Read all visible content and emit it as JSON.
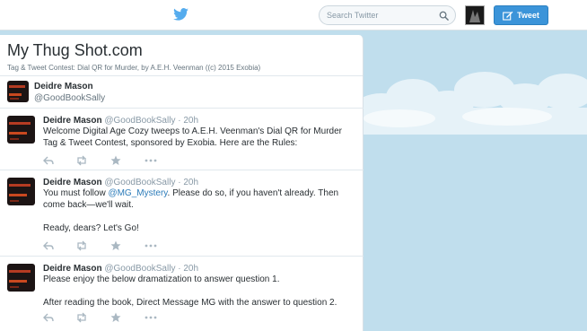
{
  "nav": {
    "search_placeholder": "Search Twitter",
    "tweet_button_label": "Tweet"
  },
  "page": {
    "title": "My Thug Shot.com",
    "subtitle": "Tag & Tweet Contest: Dial QR for Murder, by A.E.H. Veenman ((c) 2015 Exobia)"
  },
  "profile": {
    "name": "Deidre Mason",
    "handle": "@GoodBookSally"
  },
  "tweets": [
    {
      "name": "Deidre Mason",
      "handle": "@GoodBookSally",
      "separator": "·",
      "time": "20h",
      "text1": "Welcome Digital Age Cozy tweeps to A.E.H. Veenman's Dial QR for Murder Tag & Tweet Contest, sponsored by Exobia. Here are the Rules:"
    },
    {
      "name": "Deidre Mason",
      "handle": "@GoodBookSally",
      "separator": "·",
      "time": "20h",
      "text1_before": "You must follow ",
      "mention": "@MG_Mystery",
      "text1_after": ". Please do so, if you haven't already. Then come back—we'll wait.",
      "text2": "Ready, dears? Let's Go!"
    },
    {
      "name": "Deidre Mason",
      "handle": "@GoodBookSally",
      "separator": "·",
      "time": "20h",
      "text1": "Please enjoy the below dramatization to answer question 1.",
      "text2": "After reading the book, Direct Message MG with the answer to question 2."
    }
  ],
  "icons": {
    "logo": "twitter-bird-icon",
    "search": "search-icon",
    "compose": "compose-icon",
    "reply": "reply-icon",
    "retweet": "retweet-icon",
    "favorite": "star-icon",
    "more": "more-icon"
  },
  "colors": {
    "brand": "#55acee",
    "tweet_button": "#3b94d9",
    "link": "#2b7bb9",
    "background": "#c0deed"
  }
}
